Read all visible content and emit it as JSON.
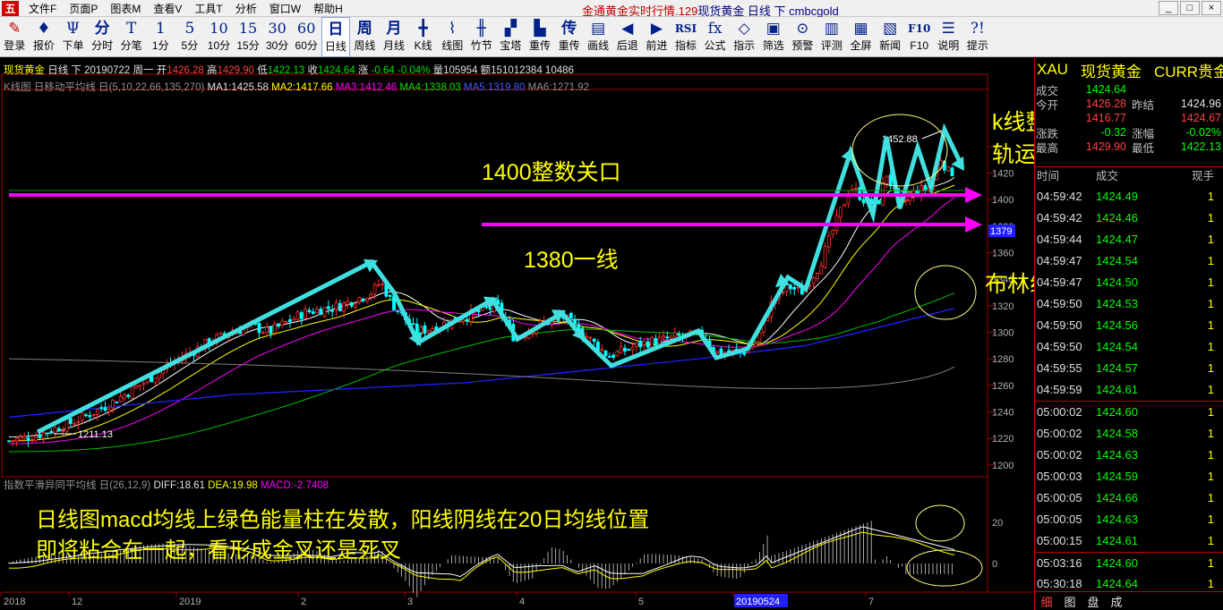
{
  "menubar": {
    "logo": "五",
    "items": [
      "文件F",
      "页面P",
      "图表M",
      "查看V",
      "工具T",
      "分析",
      "窗口W",
      "帮助H"
    ],
    "title_red": "金通黄金实时行情.129",
    "title_rest": "现货黄金 日线 下 cmbcgold",
    "window_buttons": [
      "_",
      "□",
      "×"
    ]
  },
  "toolbar": {
    "buttons": [
      {
        "icon": "pencil-icon",
        "glyph": "✎",
        "label": "登录"
      },
      {
        "icon": "tag-icon",
        "glyph": "♦",
        "label": "报价"
      },
      {
        "icon": "order-icon",
        "glyph": "Ψ",
        "label": "下单"
      },
      {
        "icon": "text-icon",
        "glyph": "分",
        "label": "分时"
      },
      {
        "icon": "text-icon",
        "glyph": "T",
        "label": "分笔"
      },
      {
        "icon": "text-icon",
        "glyph": "1",
        "label": "1分"
      },
      {
        "icon": "text-icon",
        "glyph": "5",
        "label": "5分"
      },
      {
        "icon": "text-icon",
        "glyph": "10",
        "label": "10分"
      },
      {
        "icon": "text-icon",
        "glyph": "15",
        "label": "15分"
      },
      {
        "icon": "text-icon",
        "glyph": "30",
        "label": "30分"
      },
      {
        "icon": "text-icon",
        "glyph": "60",
        "label": "60分"
      },
      {
        "icon": "text-icon",
        "glyph": "日",
        "label": "日线",
        "active": true
      },
      {
        "icon": "text-icon",
        "glyph": "周",
        "label": "周线"
      },
      {
        "icon": "text-icon",
        "glyph": "月",
        "label": "月线"
      },
      {
        "icon": "candle-icon",
        "glyph": "╋",
        "label": "K线"
      },
      {
        "icon": "line-icon",
        "glyph": "⌇",
        "label": "线图"
      },
      {
        "icon": "bar-icon",
        "glyph": "╫",
        "label": "竹节"
      },
      {
        "icon": "tower-icon",
        "glyph": "▞",
        "label": "宝塔"
      },
      {
        "icon": "text-icon",
        "glyph": "▙",
        "label": "重传"
      },
      {
        "icon": "text-icon",
        "glyph": "传",
        "label": "重传"
      },
      {
        "icon": "draw-icon",
        "glyph": "▤",
        "label": "画线"
      },
      {
        "icon": "back-icon",
        "glyph": "◀",
        "label": "后退"
      },
      {
        "icon": "forward-icon",
        "glyph": "▶",
        "label": "前进"
      },
      {
        "icon": "rsi-icon",
        "glyph": "RSI",
        "label": "指标"
      },
      {
        "icon": "formula-icon",
        "glyph": "fx",
        "label": "公式"
      },
      {
        "icon": "indicator-icon",
        "glyph": "◇",
        "label": "指示"
      },
      {
        "icon": "filter-icon",
        "glyph": "▣",
        "label": "筛选"
      },
      {
        "icon": "alert-icon",
        "glyph": "⊙",
        "label": "预警"
      },
      {
        "icon": "review-icon",
        "glyph": "▥",
        "label": "评测"
      },
      {
        "icon": "fullscreen-icon",
        "glyph": "▦",
        "label": "全屏"
      },
      {
        "icon": "news-icon",
        "glyph": "▧",
        "label": "新闻"
      },
      {
        "icon": "f10-icon",
        "glyph": "F10",
        "label": "F10"
      },
      {
        "icon": "manual-icon",
        "glyph": "☰",
        "label": "说明"
      },
      {
        "icon": "help-icon",
        "glyph": "?!",
        "label": "提示"
      }
    ]
  },
  "chart_info": {
    "symbol": "现货黄金",
    "period": "日线 下",
    "date": "20190722 周一",
    "open_label": "开",
    "open": "1426.28",
    "high_label": "高",
    "high": "1429.90",
    "low_label": "低",
    "low": "1422.13",
    "close_label": "收",
    "close": "1424.64",
    "chg_label": "涨",
    "chg": "-0.64",
    "chg_pct": "-0.04%",
    "vol_label": "量",
    "vol": "105954",
    "amt_label": "额",
    "amt": "151012384",
    "extra": "10486"
  },
  "ma_bar": {
    "name": "K线图 日移动平均线 日(5,10,22,66,135,270)",
    "ma1": "MA1:1425.58",
    "ma2": "MA2:1417.66",
    "ma3": "MA3:1412.46",
    "ma4": "MA4:1338.03",
    "ma5": "MA5:1319.80",
    "ma6": "MA6:1271.92"
  },
  "macd_bar": {
    "name": "指数平滑异同平均线 日(26,12,9)",
    "diff": "DIFF:18.61",
    "dea": "DEA:19.98",
    "macd": "MACD:-2.7408"
  },
  "annotations": {
    "a1400": "1400整数关口",
    "a1380": "1380一线",
    "kline": "k线整体在布林线上",
    "kline2": "轨运行",
    "boll": "布林线向上发散运行",
    "macd1": "日线图macd均线上绿色能量柱在发散，阳线阴线在20日均线位置",
    "macd2": "即将粘合在一起，看形成金叉还是死叉",
    "high_lbl": "1452.88",
    "low_lbl": "1211.13",
    "price_tag": "1379"
  },
  "axis": {
    "y_labels": [
      "1420",
      "1400",
      "1380",
      "1360",
      "1340",
      "1320",
      "1300",
      "1280",
      "1260",
      "1240",
      "1220",
      "1200"
    ],
    "macd_labels": [
      "20",
      "0"
    ],
    "x_labels": [
      "2018",
      "12",
      "2019",
      "2",
      "3",
      "4",
      "5",
      "20190524",
      "7"
    ]
  },
  "side": {
    "header": [
      "XAU",
      "现货黄金",
      "CURR贵金"
    ],
    "quote": [
      {
        "k": "成交",
        "v": "1424.64",
        "k2": "",
        "v2": ""
      },
      {
        "k": "今开",
        "v": "1426.28",
        "k2": "昨结",
        "v2": "1424.96"
      },
      {
        "k": "",
        "v": "1416.77",
        "k2": "",
        "v2": "1424.67"
      },
      {
        "k": "涨跌",
        "v": "-0.32",
        "k2": "涨幅",
        "v2": "-0.02%"
      },
      {
        "k": "最高",
        "v": "1429.90",
        "k2": "最低",
        "v2": "1422.13"
      }
    ],
    "ticks_header": [
      "时间",
      "成交",
      "现手"
    ],
    "ticks": [
      {
        "t": "04:59:42",
        "p": "1424.49",
        "n": "1"
      },
      {
        "t": "04:59:42",
        "p": "1424.46",
        "n": "1"
      },
      {
        "t": "04:59:44",
        "p": "1424.47",
        "n": "1"
      },
      {
        "t": "04:59:47",
        "p": "1424.54",
        "n": "1"
      },
      {
        "t": "04:59:47",
        "p": "1424.50",
        "n": "1"
      },
      {
        "t": "04:59:50",
        "p": "1424.53",
        "n": "1"
      },
      {
        "t": "04:59:50",
        "p": "1424.56",
        "n": "1"
      },
      {
        "t": "04:59:50",
        "p": "1424.54",
        "n": "1"
      },
      {
        "t": "04:59:55",
        "p": "1424.57",
        "n": "1"
      },
      {
        "t": "04:59:59",
        "p": "1424.61",
        "n": "1"
      },
      {
        "t": "05:00:02",
        "p": "1424.60",
        "n": "1"
      },
      {
        "t": "05:00:02",
        "p": "1424.58",
        "n": "1"
      },
      {
        "t": "05:00:02",
        "p": "1424.63",
        "n": "1"
      },
      {
        "t": "05:00:03",
        "p": "1424.59",
        "n": "1"
      },
      {
        "t": "05:00:05",
        "p": "1424.66",
        "n": "1"
      },
      {
        "t": "05:00:05",
        "p": "1424.63",
        "n": "1"
      },
      {
        "t": "05:00:15",
        "p": "1424.61",
        "n": "1"
      },
      {
        "t": "05:03:16",
        "p": "1424.60",
        "n": "1"
      },
      {
        "t": "05:30:18",
        "p": "1424.64",
        "n": "1"
      }
    ],
    "tabs": [
      "细",
      "图",
      "盘",
      "成"
    ]
  },
  "colors": {
    "up": "#ff3030",
    "down": "#00ffff",
    "arrow": "#40e0e0",
    "magenta": "#ff00ff",
    "ma_white": "#ffffff",
    "ma_yellow": "#ffff00",
    "ma_pink": "#ff00ff",
    "ma_green": "#00c000",
    "ma_blue": "#2020ff",
    "ma_gray": "#808080"
  }
}
